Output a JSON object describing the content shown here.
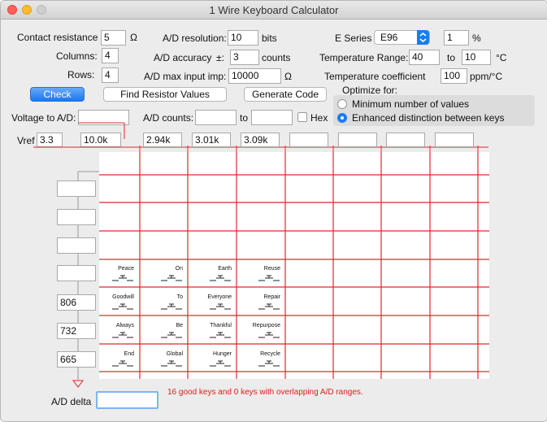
{
  "window": {
    "title": "1 Wire Keyboard Calculator"
  },
  "params": {
    "contact_resistance": {
      "label": "Contact resistance",
      "value": "5",
      "unit": "Ω"
    },
    "columns": {
      "label": "Columns:",
      "value": "4"
    },
    "rows": {
      "label": "Rows:",
      "value": "4"
    },
    "ad_resolution": {
      "label": "A/D resolution:",
      "value": "10",
      "unit": "bits"
    },
    "ad_accuracy": {
      "label": "A/D accuracy",
      "pm": "±:",
      "value": "3",
      "unit": "counts"
    },
    "ad_max_input": {
      "label": "A/D max input imp:",
      "value": "10000",
      "unit": "Ω"
    },
    "e_series": {
      "label": "E Series",
      "value": "E96",
      "tolerance": "1",
      "tolerance_unit": "%"
    },
    "temp_range": {
      "label": "Temperature Range:",
      "min": "40",
      "to": "to",
      "max": "10",
      "unit": "°C"
    },
    "temp_coeff": {
      "label": "Temperature coefficient",
      "value": "100",
      "unit": "ppm/°C"
    }
  },
  "buttons": {
    "check": "Check",
    "find": "Find Resistor Values",
    "generate": "Generate Code"
  },
  "optimize": {
    "label": "Optimize for:",
    "options": [
      "Minimum number of values",
      "Enhanced distinction between keys"
    ],
    "selected": 1
  },
  "voltage": {
    "label": "Voltage to A/D:",
    "value": ""
  },
  "ad_counts": {
    "label": "A/D counts:",
    "from": "",
    "to_label": "to",
    "to": "",
    "hex_label": "Hex"
  },
  "vref": {
    "label": "Vref",
    "value": "3.3",
    "pullup": "10.0k"
  },
  "column_resistors": [
    "2.94k",
    "3.01k",
    "3.09k",
    "",
    "",
    "",
    "",
    ""
  ],
  "row_values": [
    "",
    "",
    "",
    "",
    "806",
    "732",
    "665"
  ],
  "keys": [
    [
      "Peace",
      "On",
      "Earth",
      "Reuse"
    ],
    [
      "Goodwill",
      "To",
      "Everyone",
      "Repair"
    ],
    [
      "Always",
      "Be",
      "Thankful",
      "Repurpose"
    ],
    [
      "End",
      "Global",
      "Hunger",
      "Recycle"
    ]
  ],
  "ad_delta": {
    "label": "A/D delta",
    "value": ""
  },
  "status": "16 good keys and 0 keys with overlapping A/D ranges.",
  "colors": {
    "wire": "#d92b2b",
    "status": "#e0201a",
    "accent": "#1a7cf2"
  }
}
